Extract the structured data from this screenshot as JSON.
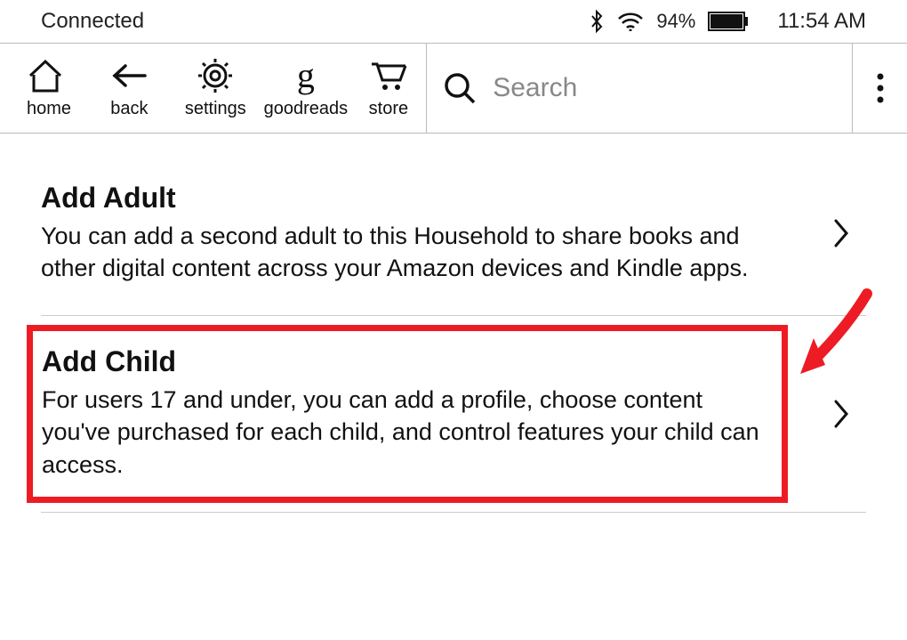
{
  "status": {
    "connection": "Connected",
    "battery_percent": "94%",
    "time": "11:54 AM"
  },
  "toolbar": {
    "home": "home",
    "back": "back",
    "settings": "settings",
    "goodreads": "goodreads",
    "store": "store"
  },
  "search": {
    "placeholder": "Search"
  },
  "options": {
    "add_adult": {
      "title": "Add Adult",
      "desc": "You can add a second adult to this Household to share books and other digital content across your Amazon devices and Kindle apps."
    },
    "add_child": {
      "title": "Add Child",
      "desc": "For users 17 and under, you can add a profile, choose content you've purchased for each child, and control features your child can access."
    }
  },
  "annotation": {
    "highlight_color": "#ed1c24"
  }
}
